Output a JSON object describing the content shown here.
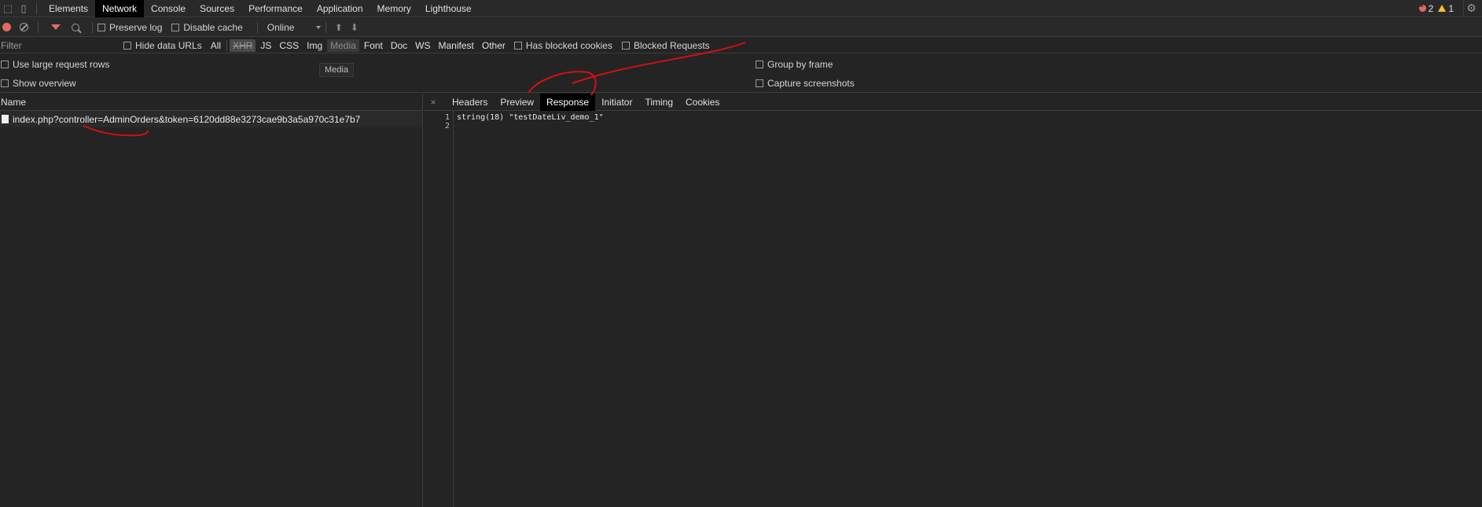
{
  "top_tabs": [
    "Elements",
    "Network",
    "Console",
    "Sources",
    "Performance",
    "Application",
    "Memory",
    "Lighthouse"
  ],
  "active_top_tab": "Network",
  "status": {
    "errors": "2",
    "warnings": "1"
  },
  "toolbar": {
    "preserve_log": "Preserve log",
    "disable_cache": "Disable cache",
    "throttling": "Online"
  },
  "filterbar": {
    "filter_placeholder": "Filter",
    "hide_data_urls": "Hide data URLs",
    "types": [
      "All",
      "XHR",
      "JS",
      "CSS",
      "Img",
      "Media",
      "Font",
      "Doc",
      "WS",
      "Manifest",
      "Other"
    ],
    "has_blocked_cookies": "Has blocked cookies",
    "blocked_requests": "Blocked Requests"
  },
  "settings": {
    "large_rows": "Use large request rows",
    "show_overview": "Show overview",
    "group_by_frame": "Group by frame",
    "capture_screenshots": "Capture screenshots"
  },
  "tooltip": "Media",
  "request_list": {
    "header": "Name",
    "rows": [
      {
        "name": "index.php?controller=AdminOrders&token=6120dd88e3273cae9b3a5a970c31e7b7"
      }
    ]
  },
  "details": {
    "close": "×",
    "tabs": [
      "Headers",
      "Preview",
      "Response",
      "Initiator",
      "Timing",
      "Cookies"
    ],
    "active_tab": "Response",
    "lines": [
      "1",
      "2"
    ],
    "response_line1": "string(18) \"testDateLiv_demo_1\"",
    "response_line2": ""
  },
  "colors": {
    "accent_red": "#e46962",
    "annotation": "#d31010",
    "warning": "#f1c232"
  }
}
